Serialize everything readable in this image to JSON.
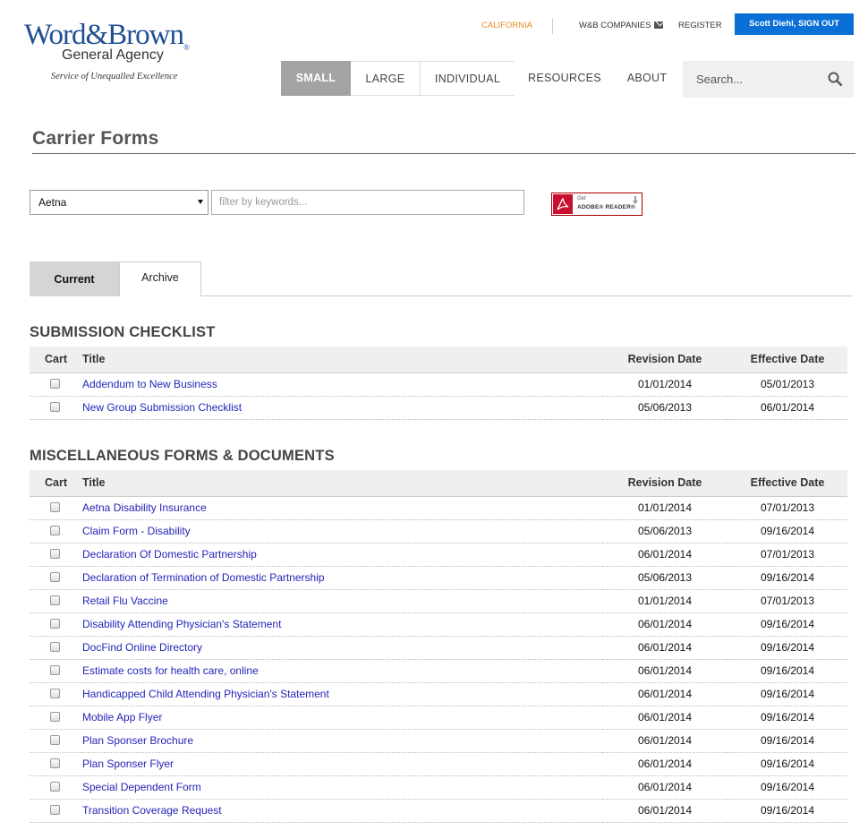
{
  "brand": {
    "name": "Word&Brown",
    "registered": "®",
    "subtitle": "General Agency",
    "tagline": "Service of Unequalled Excellence"
  },
  "topbar": {
    "state": "CALIFORNIA",
    "companies": "W&B COMPANIES",
    "register": "REGISTER",
    "signout": "Scott Diehl, SIGN OUT"
  },
  "nav": {
    "items": [
      "SMALL",
      "LARGE",
      "INDIVIDUAL",
      "RESOURCES",
      "ABOUT"
    ],
    "active": "SMALL"
  },
  "search": {
    "placeholder": "Search..."
  },
  "page": {
    "title": "Carrier Forms"
  },
  "filters": {
    "carrier_selected": "Aetna",
    "keyword_placeholder": "filter by keywords...",
    "adobe_get": "Get",
    "adobe_name": "ADOBE® READER®"
  },
  "tabs": {
    "current": "Current",
    "archive": "Archive"
  },
  "columns": {
    "cart": "Cart",
    "title": "Title",
    "revision": "Revision Date",
    "effective": "Effective Date"
  },
  "sections": [
    {
      "title": "SUBMISSION CHECKLIST",
      "rows": [
        {
          "title": "Addendum to New Business",
          "revision": "01/01/2014",
          "effective": "05/01/2013"
        },
        {
          "title": "New Group Submission Checklist",
          "revision": "05/06/2013",
          "effective": "06/01/2014"
        }
      ]
    },
    {
      "title": "MISCELLANEOUS FORMS & DOCUMENTS",
      "rows": [
        {
          "title": "Aetna Disability Insurance",
          "revision": "01/01/2014",
          "effective": "07/01/2013"
        },
        {
          "title": "Claim Form - Disability",
          "revision": "05/06/2013",
          "effective": "09/16/2014"
        },
        {
          "title": "Declaration Of Domestic Partnership",
          "revision": "06/01/2014",
          "effective": "07/01/2013"
        },
        {
          "title": "Declaration of Termination of Domestic Partnership",
          "revision": "05/06/2013",
          "effective": "09/16/2014"
        },
        {
          "title": "Retail Flu Vaccine",
          "revision": "01/01/2014",
          "effective": "07/01/2013"
        },
        {
          "title": "Disability Attending Physician's Statement",
          "revision": "06/01/2014",
          "effective": "09/16/2014"
        },
        {
          "title": "DocFind Online Directory",
          "revision": "06/01/2014",
          "effective": "09/16/2014"
        },
        {
          "title": "Estimate costs for health care, online",
          "revision": "06/01/2014",
          "effective": "09/16/2014"
        },
        {
          "title": "Handicapped Child Attending Physician's Statement",
          "revision": "06/01/2014",
          "effective": "09/16/2014"
        },
        {
          "title": "Mobile App Flyer",
          "revision": "06/01/2014",
          "effective": "09/16/2014"
        },
        {
          "title": "Plan Sponser Brochure",
          "revision": "06/01/2014",
          "effective": "09/16/2014"
        },
        {
          "title": "Plan Sponser Flyer",
          "revision": "06/01/2014",
          "effective": "09/16/2014"
        },
        {
          "title": "Special Dependent Form",
          "revision": "06/01/2014",
          "effective": "09/16/2014"
        },
        {
          "title": "Transition Coverage Request",
          "revision": "06/01/2014",
          "effective": "09/16/2014"
        }
      ]
    }
  ],
  "colors": {
    "brand_blue": "#1f4f94",
    "state_orange": "#e58a1f",
    "signout_blue": "#0a6fd6",
    "link_blue": "#2424b8",
    "active_nav_gray": "#a3a3a3"
  }
}
